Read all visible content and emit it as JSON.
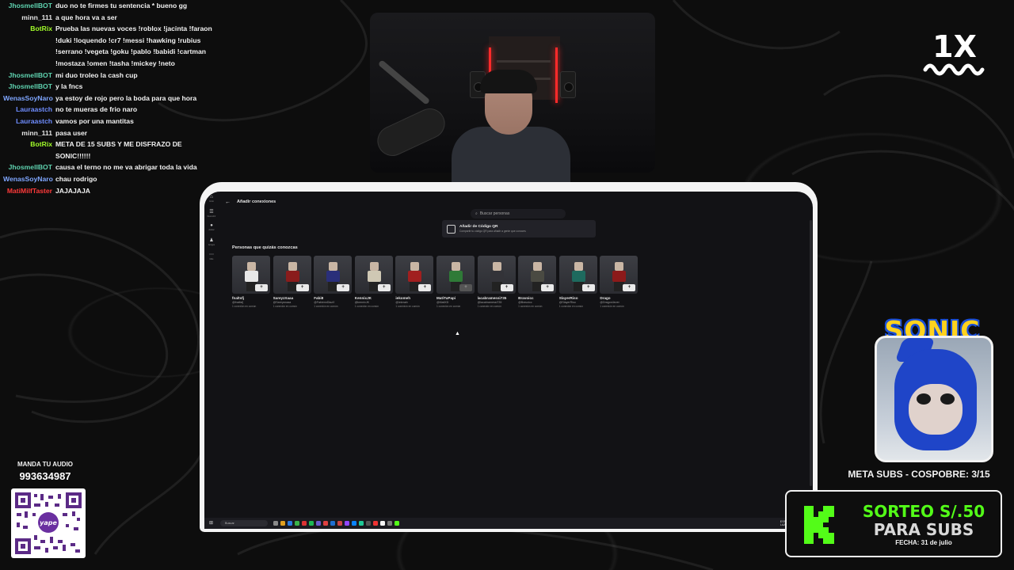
{
  "chat": [
    {
      "user": "JhosmellBOT",
      "color": "#5fd3b0",
      "msg": "duo no te firmes tu sentencia * bueno gg"
    },
    {
      "user": "minn_111",
      "color": "#e6e6e6",
      "msg": "a que hora va a ser"
    },
    {
      "user": "BotRix",
      "color": "#a3ff2a",
      "msg": "Prueba las nuevas voces !roblox !jacinta !faraon !duki !loquendo !cr7 !messi !hawking !rubius !serrano !vegeta !goku !pablo !babidi !cartman !mostaza !omen !tasha !mickey !neto"
    },
    {
      "user": "JhosmellBOT",
      "color": "#5fd3b0",
      "msg": "mi duo troleo la cash cup"
    },
    {
      "user": "JhosmellBOT",
      "color": "#5fd3b0",
      "msg": "y la fncs"
    },
    {
      "user": "WenasSoyNaro",
      "color": "#7fa6ff",
      "msg": "ya estoy de rojo pero la boda para que hora"
    },
    {
      "user": "Lauraastch",
      "color": "#6f8dff",
      "msg": "no te mueras de frio naro"
    },
    {
      "user": "Lauraastch",
      "color": "#6f8dff",
      "msg": "vamos por una mantitas"
    },
    {
      "user": "minn_111",
      "color": "#e6e6e6",
      "msg": "pasa user"
    },
    {
      "user": "BotRix",
      "color": "#a3ff2a",
      "msg": "META DE 15 SUBS Y ME DISFRAZO DE SONIC!!!!!!"
    },
    {
      "user": "JhosmellBOT",
      "color": "#5fd3b0",
      "msg": "causa el terno no me va abrigar toda la vida"
    },
    {
      "user": "WenasSoyNaro",
      "color": "#7fa6ff",
      "msg": "chau rodrigo"
    },
    {
      "user": "MatiMilfTaster",
      "color": "#ff3a3a",
      "msg": "JAJAJAJA"
    }
  ],
  "logo": {
    "text": "1X"
  },
  "app": {
    "back_icon": "←",
    "title": "Añadir conexiones",
    "search_placeholder": "Buscar personas",
    "qr_title": "Añadir de Código QR",
    "qr_subtitle": "Compartir tu código QR para añadir a gente que conoces",
    "section_title": "Personas que quizás conozcas",
    "sidebar": [
      {
        "icon": "⌂",
        "label": "Inicio"
      },
      {
        "icon": "☰",
        "label": "Descubrir"
      },
      {
        "icon": "●",
        "label": "Avatar"
      },
      {
        "icon": "♟",
        "label": "Amigos"
      },
      {
        "icon": "⋯",
        "label": "Más"
      }
    ],
    "people": [
      {
        "name": "fnaltsfj",
        "handle": "@fnaltsfj",
        "mutual": "1 conexión en común",
        "shirt": "#e8e8e8",
        "added": false
      },
      {
        "name": "SareyzXaaa",
        "handle": "@Sareyzxaaa",
        "mutual": "1 conexión en común",
        "shirt": "#8a1c1c",
        "added": false
      },
      {
        "name": "Fabi8",
        "handle": "@FabiennDiazX",
        "mutual": "1 conexión en común",
        "shirt": "#2a2f7a",
        "added": false
      },
      {
        "name": "KennixJK",
        "handle": "@kennixJK",
        "mutual": "1 conexión en común",
        "shirt": "#cfc8b4",
        "added": false
      },
      {
        "name": "iekomeh",
        "handle": "@iekmah",
        "mutual": "1 conexión en común",
        "shirt": "#a11f1f",
        "added": false
      },
      {
        "name": "MatiTuPapi",
        "handle": "@MatiXD",
        "mutual": "1 conexión en común",
        "shirt": "#2f7a37",
        "added": true
      },
      {
        "name": "lacabramessi735",
        "handle": "@lacabramessi735",
        "mutual": "1 conexión en común",
        "shirt": "#333338",
        "added": false
      },
      {
        "name": "Bravoicc",
        "handle": "@Bravoicc",
        "mutual": "1 conexión en común",
        "shirt": "#4a4a42",
        "added": false
      },
      {
        "name": "SlayerRiso",
        "handle": "@SlayerRiso",
        "mutual": "1 conexión en común",
        "shirt": "#1e6a5e",
        "added": false
      },
      {
        "name": "Drago",
        "handle": "@Dragon4ever",
        "mutual": "1 conexión en común",
        "shirt": "#8c1a1a",
        "added": false
      }
    ],
    "taskbar": {
      "search": "Buscar",
      "tray_lang": "ESP",
      "tray_kb": "LAA"
    }
  },
  "sonic": {
    "title": "SONIC",
    "goal": "META SUBS - COSPOBRE: 3/15"
  },
  "sorteo": {
    "line1": "SORTEO S/.50",
    "line2": "PARA SUBS",
    "date": "FECHA: 31 de julio",
    "brand_color": "#53fc18"
  },
  "audio": {
    "label": "MANDA TU AUDIO",
    "phone": "993634987",
    "qr_brand": "yape"
  }
}
